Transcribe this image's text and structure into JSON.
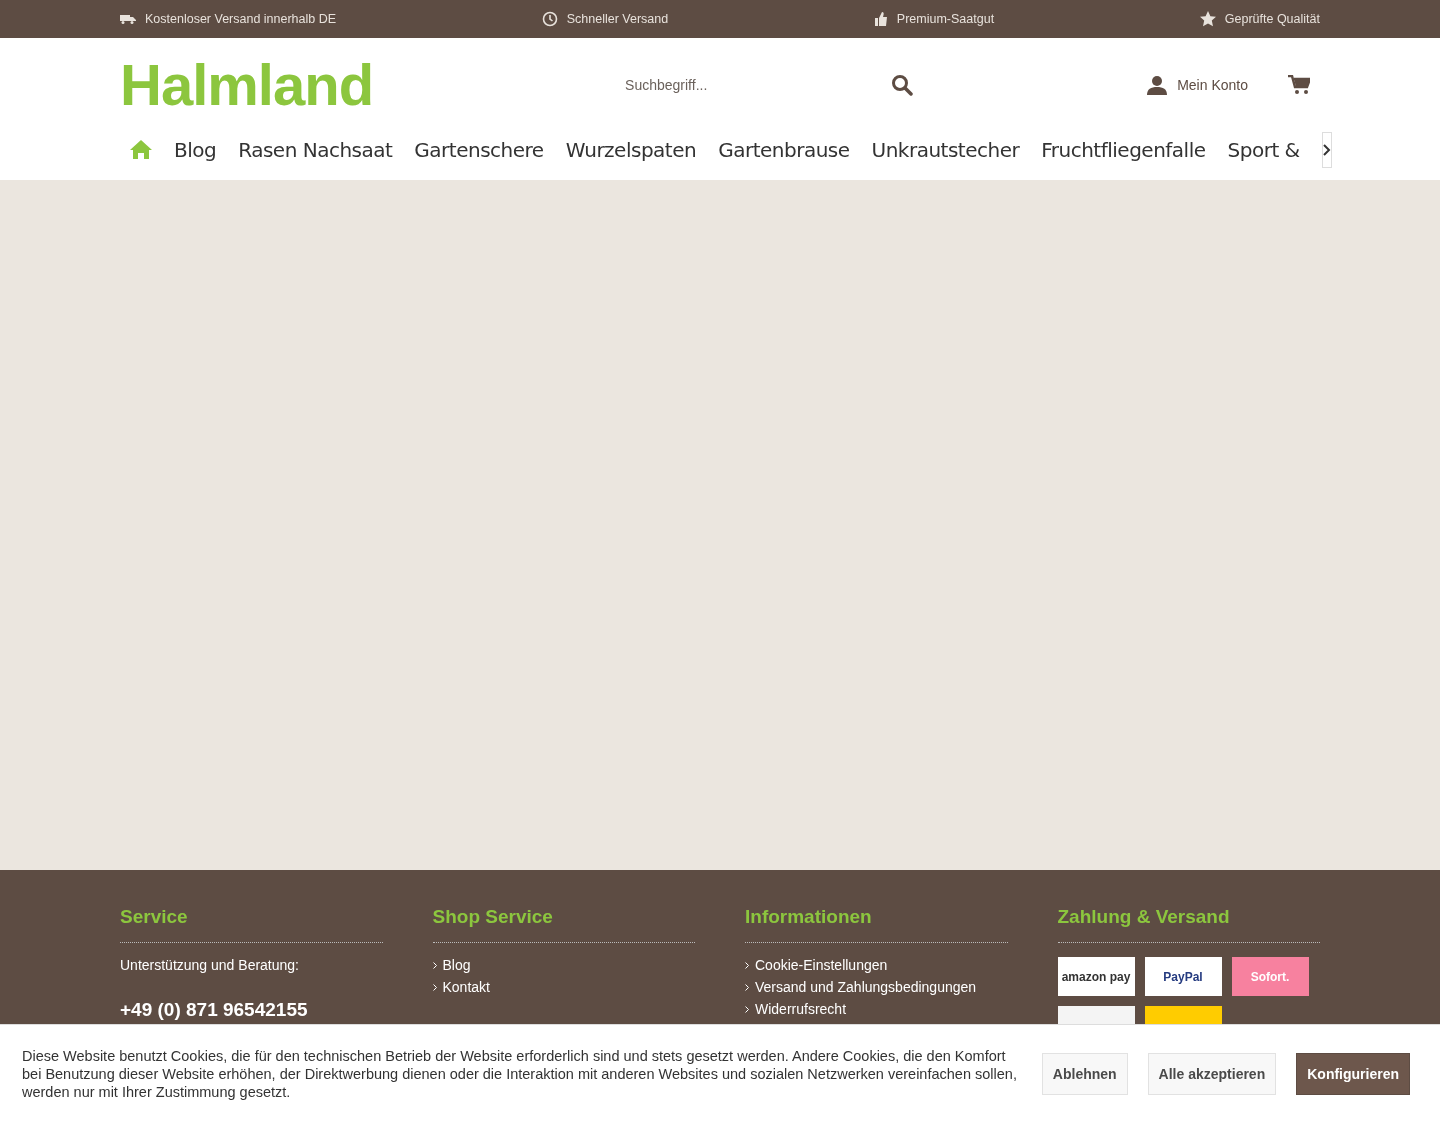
{
  "top_bar": {
    "items": [
      {
        "kind": "truck",
        "label": "Kostenloser Versand innerhalb DE"
      },
      {
        "kind": "clock",
        "label": "Schneller Versand"
      },
      {
        "kind": "thumb",
        "label": "Premium-Saatgut"
      },
      {
        "kind": "star",
        "label": "Geprüfte Qualität"
      }
    ]
  },
  "header": {
    "logo": "Halmland",
    "search": {
      "placeholder": "Suchbegriff..."
    },
    "account": "Mein Konto"
  },
  "nav": {
    "items": [
      "Blog",
      "Rasen Nachsaat",
      "Gartenschere",
      "Wurzelspaten",
      "Gartenbrause",
      "Unkrautstecher",
      "Fruchtfliegenfalle",
      "Sport &"
    ]
  },
  "footer": {
    "columns": [
      {
        "kind": "text",
        "title": "Service",
        "text": "Unterstützung und Beratung:",
        "phone": "+49 (0) 871 96542155"
      },
      {
        "kind": "links",
        "title": "Shop Service",
        "links": [
          "Blog",
          "Kontakt"
        ]
      },
      {
        "kind": "links",
        "title": "Informationen",
        "links": [
          "Cookie-Einstellungen",
          "Versand und Zahlungsbedingungen",
          "Widerrufsrecht"
        ]
      },
      {
        "kind": "payments",
        "title": "Zahlung & Versand",
        "logos": [
          {
            "kind": "amazon",
            "text": "amazon pay"
          },
          {
            "kind": "paypal",
            "text": "PayPal"
          },
          {
            "kind": "sofort",
            "text": "Sofort."
          },
          {
            "kind": "plain"
          },
          {
            "kind": "yellow"
          }
        ]
      }
    ]
  },
  "cookie_bar": {
    "text": "Diese Website benutzt Cookies, die für den technischen Betrieb der Website erforderlich sind und stets gesetzt werden. Andere Cookies, die den Komfort bei Benutzung dieser Website erhöhen, der Direktwerbung dienen oder die Interaktion mit anderen Websites und sozialen Netzwerken vereinfachen sollen, werden nur mit Ihrer Zustimmung gesetzt.",
    "buttons": [
      {
        "kind": "secondary",
        "label": "Ablehnen"
      },
      {
        "kind": "secondary",
        "label": "Alle akzeptieren"
      },
      {
        "kind": "primary",
        "label": "Konfigurieren"
      }
    ]
  }
}
